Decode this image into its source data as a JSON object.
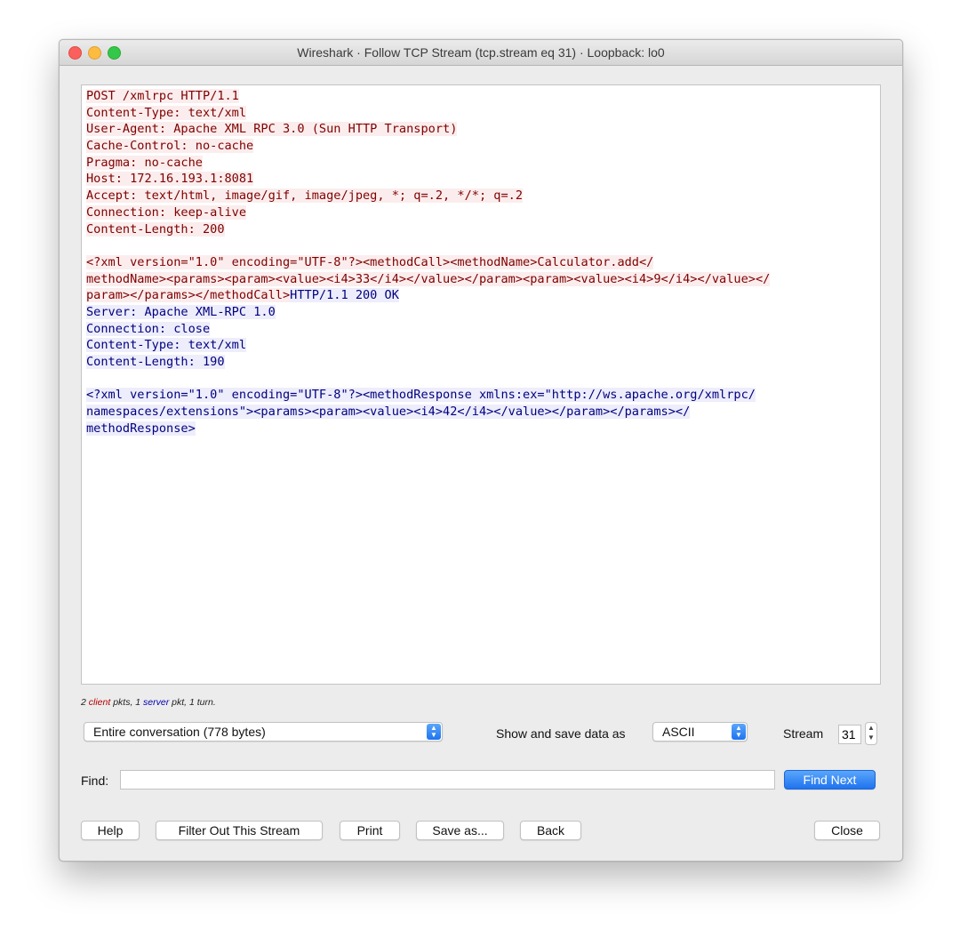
{
  "window": {
    "title": "Wireshark · Follow TCP Stream (tcp.stream eq 31) · Loopback: lo0"
  },
  "stream_lines": [
    [
      {
        "t": "POST /xmlrpc HTTP/1.1",
        "k": "client"
      }
    ],
    [
      {
        "t": "Content-Type: text/xml",
        "k": "client"
      }
    ],
    [
      {
        "t": "User-Agent: Apache XML RPC 3.0 (Sun HTTP Transport)",
        "k": "client"
      }
    ],
    [
      {
        "t": "Cache-Control: no-cache",
        "k": "client"
      }
    ],
    [
      {
        "t": "Pragma: no-cache",
        "k": "client"
      }
    ],
    [
      {
        "t": "Host: 172.16.193.1:8081",
        "k": "client"
      }
    ],
    [
      {
        "t": "Accept: text/html, image/gif, image/jpeg, *; q=.2, */*; q=.2",
        "k": "client"
      }
    ],
    [
      {
        "t": "Connection: keep-alive",
        "k": "client"
      }
    ],
    [
      {
        "t": "Content-Length: 200",
        "k": "client"
      }
    ],
    [],
    [
      {
        "t": "<?xml version=\"1.0\" encoding=\"UTF-8\"?><methodCall><methodName>Calculator.add</",
        "k": "client"
      }
    ],
    [
      {
        "t": "methodName><params><param><value><i4>33</i4></value></param><param><value><i4>9</i4></value></",
        "k": "client"
      }
    ],
    [
      {
        "t": "param></params></methodCall>",
        "k": "client"
      },
      {
        "t": "HTTP/1.1 200 OK",
        "k": "server"
      }
    ],
    [
      {
        "t": "Server: Apache XML-RPC 1.0",
        "k": "server"
      }
    ],
    [
      {
        "t": "Connection: close",
        "k": "server"
      }
    ],
    [
      {
        "t": "Content-Type: text/xml",
        "k": "server"
      }
    ],
    [
      {
        "t": "Content-Length: 190",
        "k": "server"
      }
    ],
    [],
    [
      {
        "t": "<?xml version=\"1.0\" encoding=\"UTF-8\"?><methodResponse xmlns:ex=\"http://ws.apache.org/xmlrpc/",
        "k": "server"
      }
    ],
    [
      {
        "t": "namespaces/extensions\"><params><param><value><i4>42</i4></value></param></params></",
        "k": "server"
      }
    ],
    [
      {
        "t": "methodResponse>",
        "k": "server"
      }
    ]
  ],
  "summary": {
    "client_count": "2",
    "client_word": "client",
    "middle": " pkts, 1 ",
    "server_word": "server",
    "tail": " pkt, 1 turn."
  },
  "conversation_select": {
    "value": "Entire conversation (778 bytes)"
  },
  "show_as": {
    "label": "Show and save data as",
    "value": "ASCII"
  },
  "stream": {
    "label": "Stream",
    "value": "31"
  },
  "find": {
    "label": "Find:",
    "value": "",
    "button": "Find Next"
  },
  "buttons": {
    "help": "Help",
    "filter_out": "Filter Out This Stream",
    "print": "Print",
    "save_as": "Save as...",
    "back": "Back",
    "close": "Close"
  },
  "colors": {
    "client": "#7f0000",
    "server": "#00007f",
    "accent": "#1f73ef"
  },
  "icons": {
    "select_arrows": "up-down-chevron-icon",
    "stepper": "stepper-icon"
  }
}
